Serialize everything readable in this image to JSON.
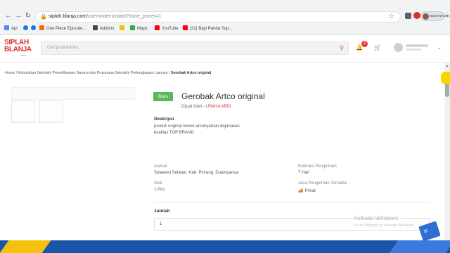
{
  "browser": {
    "url_host": "siplah.blanja.com",
    "url_path": "/user/order-instant?zone_prices=1",
    "profile_name": "BUKANTLRK",
    "bookmarks": [
      {
        "label": "Apl",
        "color": "#4c8bf5"
      },
      {
        "label": "",
        "color": "#1877f2"
      },
      {
        "label": "",
        "color": "#1a73e8"
      },
      {
        "label": "One Piece Episode...",
        "color": "#e8710a"
      },
      {
        "label": "Addons",
        "color": "#444444"
      },
      {
        "label": "",
        "color": "#fbbc04"
      },
      {
        "label": "Maps",
        "color": "#34a853"
      },
      {
        "label": "YouTube",
        "color": "#ff0000"
      },
      {
        "label": "(22) Bayi Panda Sup...",
        "color": "#ff0000"
      }
    ]
  },
  "site": {
    "logo_line1": "SIPLAH",
    "logo_line2": "BLANJA",
    "logo_line3": ".com",
    "search_placeholder": "Cari produk/toko...",
    "notification_count": "4"
  },
  "breadcrumb": {
    "path": "Home / Kebutuhan Sekolah/ Pemeliharaan Sarana dan Prasarana Sekolah/ Perlengkapan Lainnya / ",
    "current": "Gerobak Artco original"
  },
  "product": {
    "badge": "Baru",
    "title": "Gerobak Artco original",
    "seller_prefix": "Dijual Oleh - ",
    "seller_name": "USAHA ABDI",
    "desc_heading": "Deskripsi",
    "desc_line1": "produk original merek arconyaman digunakan",
    "desc_line2": "kualitas TOP BRAND",
    "alamat_label": "Alamat",
    "alamat_value": "Sulawesi Selatan, Kab. Pinrang, Duampanua",
    "estimasi_label": "Estimasi Pengiriman",
    "estimasi_value": "7 Hari",
    "stok_label": "Stok",
    "stok_value": "1 Pcs",
    "jasa_label": "Jasa Pengiriman Tersedia",
    "jasa_value": "Privat",
    "jumlah_label": "Jumlah",
    "jumlah_value": "1"
  },
  "watermark": {
    "line1": "Activate Windows",
    "line2": "Go to Settings to activate Windows."
  },
  "colors": {
    "brand_red": "#d9302c",
    "badge_green": "#5cb85c",
    "accent_yellow": "#f6d400",
    "bottom_blue": "#1a56a8"
  }
}
